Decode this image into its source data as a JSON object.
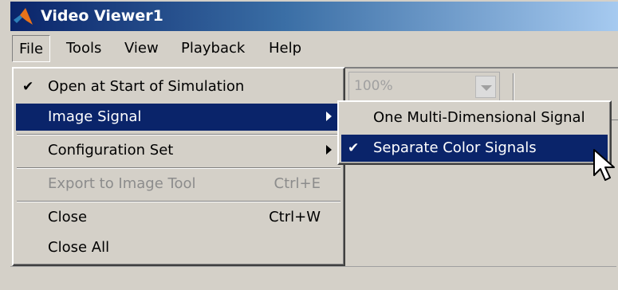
{
  "window": {
    "title": "Video Viewer1"
  },
  "menubar": {
    "items": [
      {
        "label": "File",
        "active": true
      },
      {
        "label": "Tools"
      },
      {
        "label": "View"
      },
      {
        "label": "Playback"
      },
      {
        "label": "Help"
      }
    ]
  },
  "toolbar": {
    "zoom_value": "100%"
  },
  "file_menu": {
    "items": [
      {
        "label": "Open at Start of Simulation",
        "checked": true
      },
      {
        "label": "Image Signal",
        "has_submenu": true,
        "highlighted": true
      },
      {
        "label": "Configuration Set",
        "has_submenu": true
      },
      {
        "label": "Export to Image Tool",
        "shortcut": "Ctrl+E",
        "disabled": true
      },
      {
        "label": "Close",
        "shortcut": "Ctrl+W"
      },
      {
        "label": "Close All"
      }
    ]
  },
  "image_signal_submenu": {
    "items": [
      {
        "label": "One Multi-Dimensional Signal"
      },
      {
        "label": "Separate Color Signals",
        "checked": true,
        "highlighted": true
      }
    ]
  },
  "glyphs": {
    "check": "✔"
  },
  "colors": {
    "highlight": "#0a246a",
    "titlebar_start": "#0a246a",
    "titlebar_end": "#a6caf0",
    "face": "#d4d0c8"
  },
  "icons": [
    "matlab-logo-icon",
    "checkmark-icon",
    "submenu-arrow-icon",
    "dropdown-arrow-icon",
    "mouse-pointer-icon"
  ]
}
